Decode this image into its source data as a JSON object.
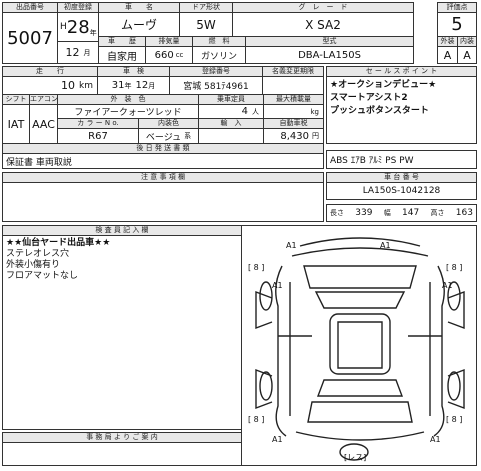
{
  "header": {
    "lot_label": "出品番号",
    "lot": "5007",
    "year_label": "初度登録",
    "year_era": "H",
    "year": "28",
    "year_unit": "年",
    "month": "12",
    "month_unit": "月",
    "name_label": "車　　名",
    "name": "ムーヴ",
    "door_label": "ドア形状",
    "door": "5W",
    "grade_label": "グ　レ　ー　ド",
    "grade": "X SA2",
    "score_label": "評価点",
    "score": "5",
    "use_label": "車　　歴",
    "use": "自家用",
    "cc_label": "排気量",
    "cc": "660",
    "cc_unit": "cc",
    "fuel_label": "燃　料",
    "fuel": "ガソリン",
    "model_label": "型式",
    "model": "DBA-LA150S",
    "ext_label": "外装",
    "int_label": "内装",
    "ext": "A",
    "int": "A"
  },
  "row2": {
    "mileage_label": "走　　行",
    "mileage": "10",
    "mileage_unit": "km",
    "inspection_label": "車　検",
    "inspection_year": "31",
    "inspection_year_unit": "年",
    "inspection_month": "12",
    "inspection_month_unit": "月",
    "plate_label": "登録番号",
    "plate": "宮城 581ﾃ4961",
    "ownership_label": "名義変更期限",
    "shift_label": "シフト",
    "shift": "IAT",
    "ac_label": "エアコン",
    "ac": "AAC",
    "color_label": "外　装　色",
    "color": "ファイアークォーツレッド",
    "capacity_label": "乗車定員",
    "capacity": "4",
    "capacity_unit": "人",
    "load_label": "最大積載量",
    "load_unit": "kg",
    "colorno_label": "カ ラ ー N o.",
    "colorno": "R67",
    "interior_label": "内装色",
    "interior": "ベージュ",
    "interior_unit": "系",
    "import_label": "輸　入",
    "price_label": "自動車税",
    "price": "8,430",
    "price_unit": "円"
  },
  "sales_point": {
    "label": "セ ー ル ス ポ イ ン ト",
    "lines": [
      "★オークションデビュー★",
      "スマートアシスト2",
      "プッシュボタンスタート"
    ]
  },
  "equipment": {
    "label": "後 日 発 送 書 類",
    "text": "保証書 車両取説"
  },
  "options": "ABS ｴｱB ｱﾙﾐ PS PW",
  "notes": {
    "label": "注 意 事 項 欄"
  },
  "chassis": {
    "label": "車 台 番 号",
    "value": "LA150S-1042128"
  },
  "dims": {
    "length_label": "長さ",
    "length": "339",
    "width_label": "幅",
    "width": "147",
    "height_label": "高さ",
    "height": "163"
  },
  "inspector": {
    "label": "検 査 員 記 入 欄",
    "lines": [
      "★★仙台ヤード出品車★★",
      "ステレオレス穴",
      "外装小傷有り",
      "フロアマットなし"
    ]
  },
  "office": {
    "label": "事 務 局 よ り ご 案 内"
  },
  "diagram": {
    "marks": [
      "A1",
      "A1",
      "A1",
      "A1",
      "A1",
      "A1"
    ],
    "tires": [
      "8",
      "8",
      "8",
      "8"
    ],
    "spare": "レス"
  }
}
